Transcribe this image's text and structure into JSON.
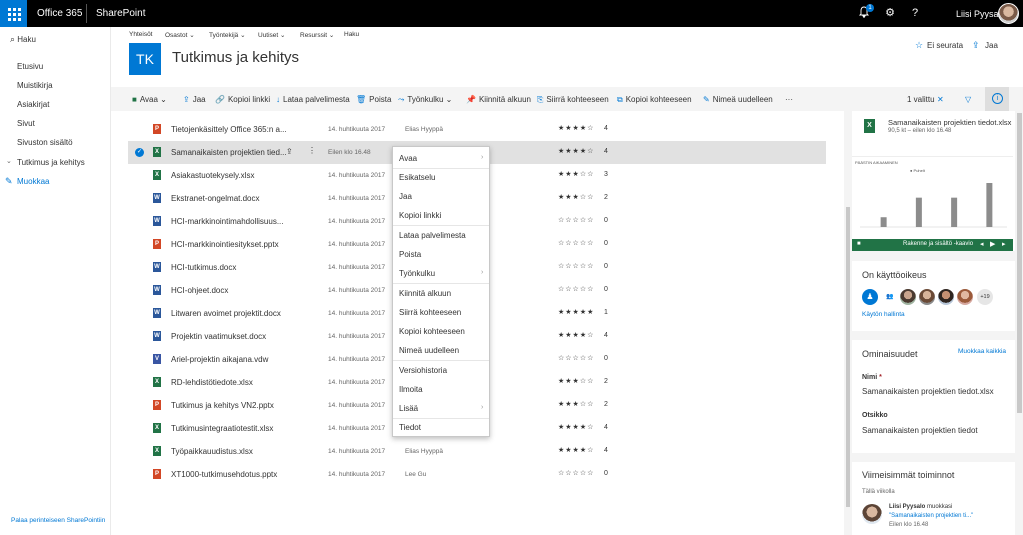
{
  "suite": {
    "app": "Office 365",
    "product": "SharePoint",
    "notifications": "1",
    "user": "Liisi Pyysalo"
  },
  "nav": {
    "search": "Haku",
    "items": [
      "Etusivu",
      "Muistikirja",
      "Asiakirjat",
      "Sivut",
      "Sivuston sisältö"
    ],
    "site": "Tutkimus ja kehitys",
    "edit": "Muokkaa",
    "return": "Palaa perinteiseen SharePointiin"
  },
  "header": {
    "links": [
      "Yhteisöt",
      "Osastot",
      "Työntekijä",
      "Uutiset",
      "Resurssit",
      "Haku"
    ],
    "tile": "TK",
    "title": "Tutkimus ja kehitys",
    "follow": "Ei seurata",
    "share": "Jaa"
  },
  "commands": [
    "Avaa",
    "Jaa",
    "Kopioi linkki",
    "Lataa palvelimesta",
    "Poista",
    "Työnkulku",
    "Kiinnitä alkuun",
    "Siirrä kohteeseen",
    "Kopioi kohteeseen",
    "Nimeä uudelleen",
    "···"
  ],
  "selection": "1 valittu",
  "files": [
    {
      "name": "Tietojenkäsittely Office 365:n a...",
      "type": "pptx",
      "date": "14. huhtikuuta 2017",
      "by": "Elias Hyyppä",
      "rating": "★★★★☆",
      "count": "4"
    },
    {
      "name": "Samanaikaisten projektien tied...",
      "type": "xlsx",
      "date": "Eilen klo 16.48",
      "by": "",
      "rating": "★★★★☆",
      "count": "4"
    },
    {
      "name": "Asiakastuotekysely.xlsx",
      "type": "xlsx",
      "date": "14. huhtikuuta 2017",
      "by": "",
      "rating": "★★★☆☆",
      "count": "3"
    },
    {
      "name": "Ekstranet-ongelmat.docx",
      "type": "docx",
      "date": "14. huhtikuuta 2017",
      "by": "",
      "rating": "★★★☆☆",
      "count": "2"
    },
    {
      "name": "HCI-markkinointimahdollisuus...",
      "type": "docx",
      "date": "14. huhtikuuta 2017",
      "by": "",
      "rating": "☆☆☆☆☆",
      "count": "0"
    },
    {
      "name": "HCI-markkinointiesitykset.pptx",
      "type": "pptx",
      "date": "14. huhtikuuta 2017",
      "by": "",
      "rating": "☆☆☆☆☆",
      "count": "0"
    },
    {
      "name": "HCI-tutkimus.docx",
      "type": "docx",
      "date": "14. huhtikuuta 2017",
      "by": "",
      "rating": "☆☆☆☆☆",
      "count": "0"
    },
    {
      "name": "HCI-ohjeet.docx",
      "type": "docx",
      "date": "14. huhtikuuta 2017",
      "by": "",
      "rating": "☆☆☆☆☆",
      "count": "0"
    },
    {
      "name": "Litwaren avoimet projektit.docx",
      "type": "docx",
      "date": "14. huhtikuuta 2017",
      "by": "",
      "rating": "★★★★★",
      "count": "1"
    },
    {
      "name": "Projektin vaatimukset.docx",
      "type": "docx",
      "date": "14. huhtikuuta 2017",
      "by": "",
      "rating": "★★★★☆",
      "count": "4"
    },
    {
      "name": "Ariel-projektin aikajana.vdw",
      "type": "vdw",
      "date": "14. huhtikuuta 2017",
      "by": "",
      "rating": "☆☆☆☆☆",
      "count": "0"
    },
    {
      "name": "RD-lehdistötiedote.xlsx",
      "type": "xlsx",
      "date": "14. huhtikuuta 2017",
      "by": "",
      "rating": "★★★☆☆",
      "count": "2"
    },
    {
      "name": "Tutkimus ja kehitys VN2.pptx",
      "type": "pptx",
      "date": "14. huhtikuuta 2017",
      "by": "",
      "rating": "★★★☆☆",
      "count": "2"
    },
    {
      "name": "Tutkimusintegraatiotestit.xlsx",
      "type": "xlsx",
      "date": "14. huhtikuuta 2017",
      "by": "",
      "rating": "★★★★☆",
      "count": "4"
    },
    {
      "name": "Työpaikkauudistus.xlsx",
      "type": "xlsx",
      "date": "14. huhtikuuta 2017",
      "by": "Elias Hyyppä",
      "rating": "★★★★☆",
      "count": "4"
    },
    {
      "name": "XT1000-tutkimusehdotus.pptx",
      "type": "pptx",
      "date": "14. huhtikuuta 2017",
      "by": "Lee Gu",
      "rating": "☆☆☆☆☆",
      "count": "0"
    }
  ],
  "context_menu": [
    "Avaa",
    "Esikatselu",
    "Jaa",
    "Kopioi linkki",
    "Lataa palvelimesta",
    "Poista",
    "Työnkulku",
    "Kiinnitä alkuun",
    "Siirrä kohteeseen",
    "Kopioi kohteeseen",
    "Nimeä uudelleen",
    "Versiohistoria",
    "Ilmoita",
    "Lisää",
    "Tiedot"
  ],
  "pane": {
    "file_name": "Samanaikaisten projektien tiedot.xlsx",
    "file_meta": "90,5 kt – eilen klo 16.48",
    "chart_title": "PÄÄSTIN AIKAAMINEN",
    "chart_legend": "Puhelt",
    "chart_caption": "Rakenne ja sisältö -kaavio",
    "access_title": "On käyttöoikeus",
    "access_more": "+19",
    "access_manage": "Käytön hallinta",
    "props_title": "Ominaisuudet",
    "props_edit": "Muokkaa kaikkia",
    "name_label": "Nimi",
    "name_required": "*",
    "name_value": "Samanaikaisten projektien tiedot.xlsx",
    "title_label": "Otsikko",
    "title_value": "Samanaikaisten projektien tiedot",
    "activity_title": "Viimeisimmät toiminnot",
    "activity_period": "Tällä viikolla",
    "activity_user": "Liisi Pyysalo",
    "activity_action": "muokkasi",
    "activity_file": "\"Samanaikaisten projektien ti...\"",
    "activity_time": "Eilen klo 16.48"
  },
  "chart_data": {
    "type": "bar",
    "categories": [
      "",
      "",
      "",
      ""
    ],
    "values": [
      2,
      6,
      6,
      9
    ],
    "title": "PÄÄSTIN AIKAAMINEN",
    "series": [
      {
        "name": "Puhelt",
        "values": [
          2,
          6,
          6,
          9
        ]
      }
    ]
  },
  "colors": {
    "accent": "#0078d4",
    "excel": "#217346",
    "word": "#2b579a",
    "powerpoint": "#d24726",
    "visio": "#3955a3"
  }
}
